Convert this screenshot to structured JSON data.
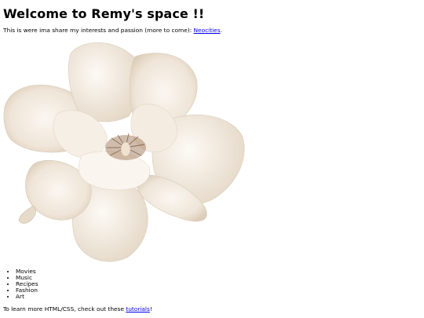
{
  "page": {
    "title": "Welcome to Remy's space !!",
    "intro_text": "This is were ima share my interests and passion (more to come): ",
    "intro_link": "Neocities",
    "intro_end": ".",
    "interests": [
      "Movies",
      "Music",
      "Recipes",
      "Fashion",
      "Art"
    ],
    "footer_text": "To learn more HTML/CSS, check out these ",
    "footer_link": "tutorials",
    "footer_end": "!"
  },
  "colors": {
    "link": "#0000ee",
    "petal": "#efe6d9",
    "petal_shadow": "#d7c9b6",
    "center": "#8c6a4f"
  }
}
